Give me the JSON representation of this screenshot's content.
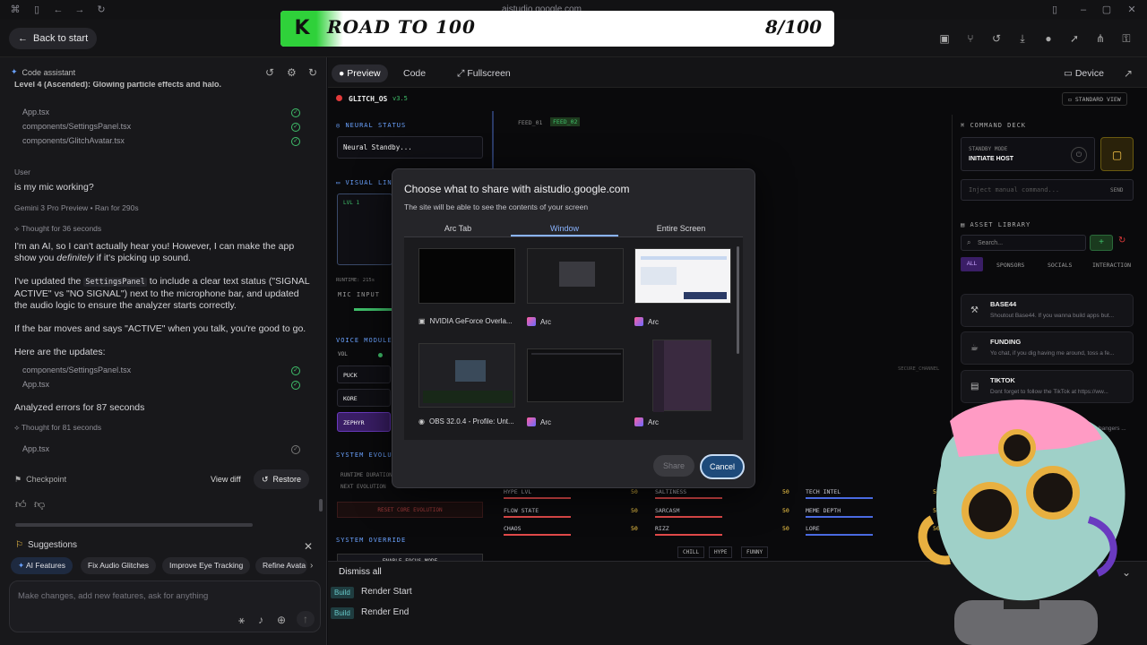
{
  "browser": {
    "url": "aistudio.google.com"
  },
  "banner": {
    "logo_letter": "K",
    "title": "ROAD TO 100",
    "progress": "8/100"
  },
  "topbar": {
    "back_label": "Back to start"
  },
  "left_panel": {
    "header": "Code assistant",
    "partial_line": "Level 4 (Ascended): Glowing particle effects and halo.",
    "files_top": [
      "App.tsx",
      "components/SettingsPanel.tsx",
      "components/GlitchAvatar.tsx"
    ],
    "user_label": "User",
    "user_message": "is my mic working?",
    "model_name": "Gemini 3 Pro Preview",
    "ran_for": "Ran for 290s",
    "thought_1": "Thought for 36 seconds",
    "reply_p1_a": "I'm an AI, so I can't actually hear you! However, I can make the app show you ",
    "reply_p1_em": "definitely",
    "reply_p1_b": " if it's picking up sound.",
    "reply_p2_a": "I've updated the ",
    "reply_p2_code": "SettingsPanel",
    "reply_p2_b": " to include a clear text status (\"SIGNAL ACTIVE\" vs \"NO SIGNAL\") next to the microphone bar, and updated the audio logic to ensure the analyzer starts correctly.",
    "reply_p3": "If the bar moves and says \"ACTIVE\" when you talk, you're good to go.",
    "updates_header": "Here are the updates:",
    "files_updates": [
      "components/SettingsPanel.tsx",
      "App.tsx"
    ],
    "analyzed": "Analyzed errors for 87 seconds",
    "thought_2": "Thought for 81 seconds",
    "file_last": "App.tsx",
    "checkpoint": "Checkpoint",
    "view_diff": "View diff",
    "restore": "Restore",
    "suggestions_header": "Suggestions",
    "suggestions": [
      "AI Features",
      "Fix Audio Glitches",
      "Improve Eye Tracking",
      "Refine Avata"
    ],
    "prompt_placeholder": "Make changes, add new features, ask for anything"
  },
  "preview_tabs": {
    "preview": "Preview",
    "code": "Code",
    "fullscreen": "Fullscreen",
    "device": "Device"
  },
  "glitch_app": {
    "os_name": "GLITCH_OS",
    "version": "v3.5",
    "standard_view": "STANDARD VIEW",
    "neural_status_label": "NEURAL STATUS",
    "neural_standby": "Neural Standby...",
    "visual_link": "VISUAL LINK",
    "lvl": "LVL 1",
    "runtime": "RUNTIME: 215s",
    "mic_input": "MIC INPUT",
    "voice_module": "VOICE MODULE",
    "vol": "VOL",
    "voices": [
      "PUCK",
      "KORE",
      "ZEPHYR"
    ],
    "system_evo": "SYSTEM EVOLUTION",
    "runtime_dur": "RUNTIME DURATION",
    "next_evo": "NEXT EVOLUTION",
    "reset_core": "RESET CORE EVOLUTION",
    "system_override": "SYSTEM OVERRIDE",
    "enable_focus": "ENABLE FOCUS MODE",
    "feed_1": "FEED_01",
    "feed_2": "FEED_02",
    "secure_channel": "SECURE_CHANNEL",
    "stats": [
      {
        "label": "HYPE LVL",
        "value": "50"
      },
      {
        "label": "FLOW STATE",
        "value": "50"
      },
      {
        "label": "CHAOS",
        "value": "50"
      },
      {
        "label": "SALTINESS",
        "value": "50"
      },
      {
        "label": "SARCASM",
        "value": "50"
      },
      {
        "label": "RIZZ",
        "value": "50"
      },
      {
        "label": "TECH INTEL",
        "value": "50"
      },
      {
        "label": "MEME DEPTH",
        "value": "50"
      },
      {
        "label": "LORE",
        "value": "50"
      }
    ],
    "moods": [
      "CHILL",
      "HYPE",
      "FUNNY"
    ],
    "command_deck": "COMMAND DECK",
    "standby_mode": "STANDBY MODE",
    "initiate_host": "INITIATE HOST",
    "inject_placeholder": "Inject manual command...",
    "send": "SEND",
    "asset_library": "ASSET LIBRARY",
    "search_placeholder": "Search...",
    "filters": [
      "ALL",
      "SPONSORS",
      "SOCIALS",
      "INTERACTION"
    ],
    "assets": [
      {
        "title": "BASE44",
        "sub": "Shoutout Base44. If you wanna build apps but..."
      },
      {
        "title": "FUNDING",
        "sub": "Yo chat, if you dig having me around, toss a fe..."
      },
      {
        "title": "TIKTOK",
        "sub": "Dont forget to follow the TikTok at https://ww..."
      }
    ],
    "asset_partial": "bangers ..."
  },
  "share_dialog": {
    "title": "Choose what to share with aistudio.google.com",
    "subtitle": "The site will be able to see the contents of your screen",
    "tabs": [
      "Arc Tab",
      "Window",
      "Entire Screen"
    ],
    "windows": [
      {
        "label": "NVIDIA GeForce Overla..."
      },
      {
        "label": "Arc"
      },
      {
        "label": "Arc"
      },
      {
        "label": "OBS 32.0.4 - Profile: Unt..."
      },
      {
        "label": "Arc"
      },
      {
        "label": "Arc"
      }
    ],
    "share": "Share",
    "cancel": "Cancel"
  },
  "build_log": {
    "dismiss": "Dismiss all",
    "entries": [
      {
        "badge": "Build",
        "text": "Render Start"
      },
      {
        "badge": "Build",
        "text": "Render End"
      }
    ]
  },
  "colors": {
    "accent_green": "#2fd13a",
    "link_blue": "#8ab4ff",
    "check_green": "#3fbf6a",
    "glitch_blue": "#6aa2ff"
  }
}
